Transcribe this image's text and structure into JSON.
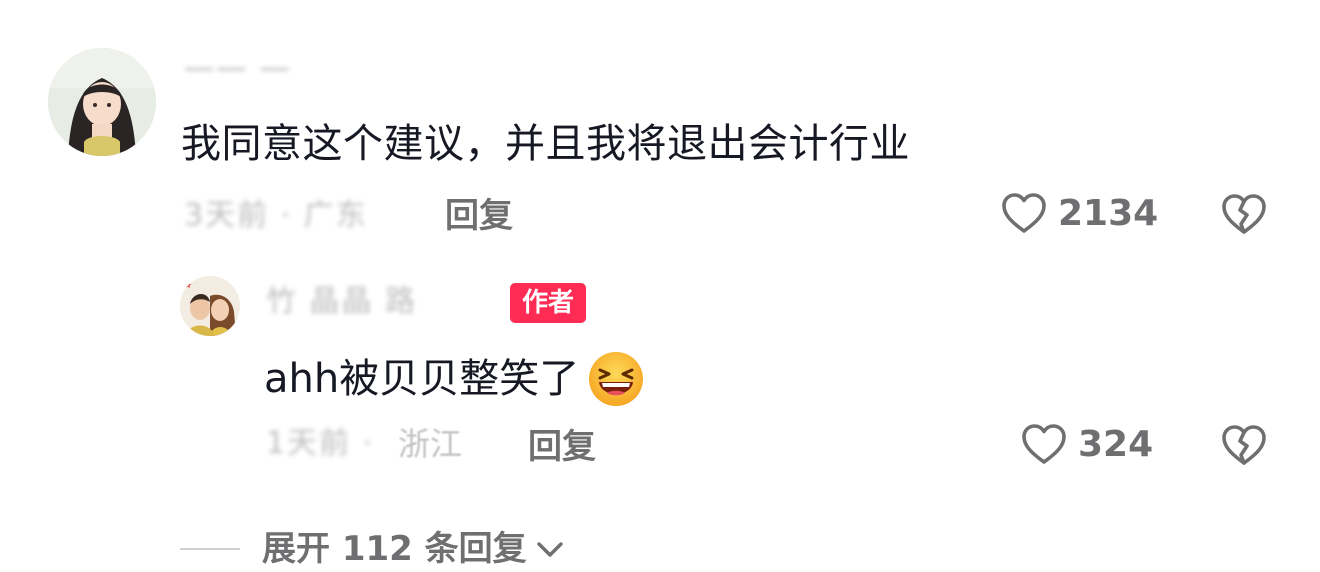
{
  "comment": {
    "username": "一一 一",
    "text": "我同意这个建议，并且我将退出会计行业",
    "meta": "3天前 · 广东",
    "reply_label": "回复",
    "like_count": "2134"
  },
  "reply": {
    "username": "竹 晶晶 路",
    "author_badge": "作者",
    "text": "ahh被贝贝整笑了",
    "emoji": "laughing-face-emoji",
    "time": "1天前 ·",
    "location": "浙江",
    "reply_label": "回复",
    "like_count": "324"
  },
  "expand": {
    "label": "展开 112 条回复"
  },
  "icons": {
    "like": "heart-icon",
    "dislike": "broken-heart-icon",
    "expand": "chevron-down-icon"
  },
  "colors": {
    "badge": "#fe2c55",
    "secondary_text": "#6f6f72",
    "primary_text": "#161823"
  }
}
